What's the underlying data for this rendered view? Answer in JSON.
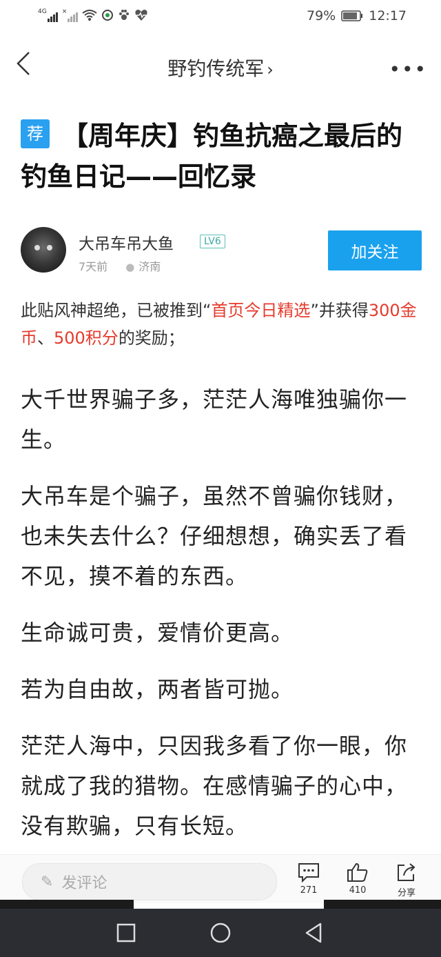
{
  "status_bar": {
    "network": "4G",
    "battery": "79%",
    "time": "12:17"
  },
  "header": {
    "title": "野钓传统军",
    "title_chevron": "›",
    "more": "•••"
  },
  "post": {
    "badge": "荐",
    "title": "【周年庆】钓鱼抗癌之最后的钓鱼日记——回忆录"
  },
  "author": {
    "name": "大吊车吊大鱼",
    "level": "LV6",
    "time": "7天前",
    "location": "济南",
    "follow_label": "加关注"
  },
  "notice": {
    "part1": "此贴风神超绝，已被推到",
    "quote_open": "“",
    "highlight1": "首页今日精选",
    "quote_close": "”",
    "part2": "并获得",
    "highlight2": "300金币",
    "sep": "、",
    "highlight3": "500积分",
    "part3": "的奖励；"
  },
  "body_paragraphs": [
    "大千世界骗子多，茫茫人海唯独骗你一生。",
    "大吊车是个骗子，虽然不曾骗你钱财，也未失去什么？仔细想想，确实丢了看不见，摸不着的东西。",
    "生命诚可贵，爱情价更高。",
    "若为自由故，两者皆可抛。",
    "茫茫人海中，只因我多看了你一眼，你就成了我的猎物。在感情骗子的心中，没有欺骗，只有长短。"
  ],
  "bottom_bar": {
    "comment_placeholder": "发评论",
    "comments_count": "271",
    "likes_count": "410",
    "share_label": "分享"
  }
}
